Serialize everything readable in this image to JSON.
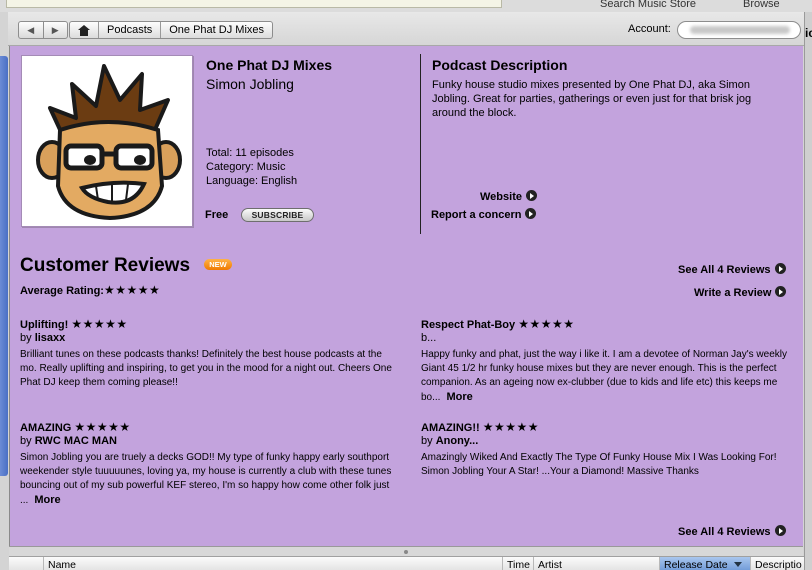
{
  "topbar": {
    "search_label": "Search Music Store",
    "browse_label": "Browse"
  },
  "nav": {
    "back_icon": "back-arrow-icon",
    "forward_icon": "forward-arrow-icon",
    "home_icon": "home-icon",
    "breadcrumbs": [
      "Podcasts",
      "One Phat DJ Mixes"
    ],
    "account_label": "Account:",
    "account_value": "••••••••••••••••"
  },
  "podcast": {
    "title": "One Phat DJ Mixes",
    "author": "Simon Jobling",
    "total": "Total: 11 episodes",
    "category": "Category: Music",
    "language": "Language: English",
    "price": "Free",
    "subscribe_label": "SUBSCRIBE"
  },
  "description": {
    "heading": "Podcast Description",
    "text": "Funky house studio mixes presented by One Phat DJ, aka Simon Jobling. Great for parties, gatherings or even just for that brisk jog around the block.",
    "website_label": "Website",
    "report_label": "Report a concern"
  },
  "reviews": {
    "heading": "Customer Reviews",
    "badge": "NEW",
    "average_label": "Average Rating:",
    "average_stars": "★★★★★",
    "see_all_label": "See All 4 Reviews",
    "write_label": "Write a Review",
    "items": [
      {
        "title": "Uplifting!",
        "stars": "★★★★★",
        "by": "by",
        "author": "lisaxx",
        "text": "Brilliant tunes on these podcasts thanks! Definitely the best house podcasts at the mo. Really uplifting and inspiring, to get you in the mood for a night out. Cheers One Phat DJ keep them coming please!!",
        "more": ""
      },
      {
        "title": "Respect Phat-Boy",
        "stars": "★★★★★",
        "by": "b...",
        "author": "",
        "text": "Happy funky and phat, just the way i like it. I am a devotee of Norman Jay's weekly Giant 45 1/2 hr funky house mixes but they are never enough. This is the perfect companion. As an ageing now ex-clubber (due to kids and life etc) this keeps me bo...",
        "more": "More"
      },
      {
        "title": "AMAZING",
        "stars": "★★★★★",
        "by": "by",
        "author": "RWC MAC MAN",
        "text": "Simon Jobling you are truely a decks GOD!! My type of funky happy early southport weekender style tuuuuunes, loving ya, my house is currently a club with these tunes bouncing out of my sub powerful KEF stereo, I'm so happy how come other folk just ...",
        "more": "More"
      },
      {
        "title": "AMAZING!!",
        "stars": "★★★★★",
        "by": "by",
        "author": "Anony...",
        "text": "Amazingly Wiked And Exactly The Type Of Funky House Mix I Was Looking For! Simon Jobling Your A Star! ...Your a Diamond! Massive Thanks",
        "more": ""
      }
    ]
  },
  "table": {
    "columns": [
      "Name",
      "Time",
      "Artist",
      "Release Date",
      "Descriptio"
    ],
    "sorted_column": "Release Date"
  },
  "colors": {
    "content_bg": "#c3a3dd",
    "badge": "#f07a00",
    "sorted_col": "#6f9ad8"
  }
}
